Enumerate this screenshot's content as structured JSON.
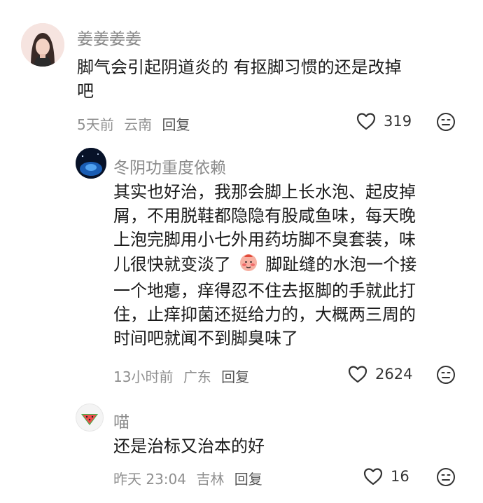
{
  "comments": [
    {
      "username": "姜姜姜姜",
      "lines": [
        "脚气会引起阴道炎的 有抠脚习惯的还是改掉",
        "吧"
      ],
      "time": "5天前",
      "location": "云南",
      "reply_label": "回复",
      "likes": "319"
    },
    {
      "username": "冬阴功重度依赖",
      "lines": [
        "其实也好治，我那会脚上长水泡、起皮掉",
        "屑，不用脱鞋都隐隐有股咸鱼味，每天晚",
        "上泡完脚用小七外用药坊脚不臭套装，味",
        "儿很快就变淡了",
        "一个地瘪，痒得忍不住去抠脚的手就此打",
        "住，止痒抑菌还挺给力的，大概两三周的",
        "时间吧就闻不到脚臭味了"
      ],
      "line4_tail": "脚趾缝的水泡一个接",
      "time": "13小时前",
      "location": "广东",
      "reply_label": "回复",
      "likes": "2624"
    },
    {
      "username": "喵",
      "lines": [
        "还是治标又治本的好"
      ],
      "time": "昨天 23:04",
      "location": "吉林",
      "reply_label": "回复",
      "likes": "16"
    }
  ],
  "icons": {
    "like": "heart-outline-icon",
    "dislike": "frown-face-icon",
    "inline_emoji": "blushing-face-emoji"
  },
  "colors": {
    "username": "#8a8a8a",
    "text": "#1a1a1a",
    "meta": "#8f8f8f"
  }
}
